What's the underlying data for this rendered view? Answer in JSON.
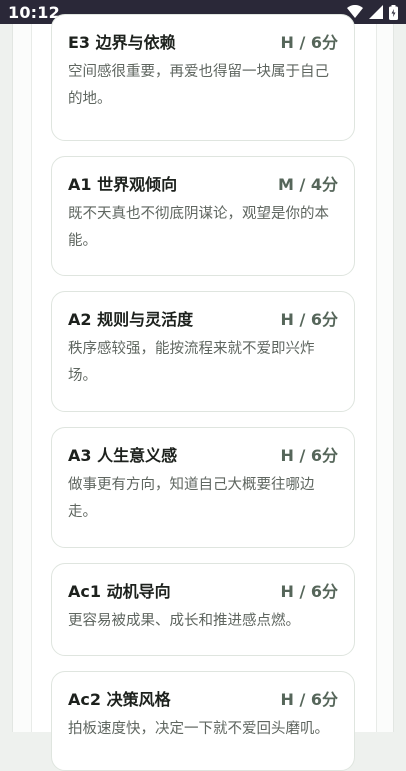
{
  "status_bar": {
    "time": "10:12"
  },
  "cards": [
    {
      "title": "E3 边界与依赖",
      "score": "H / 6分",
      "desc": "空间感很重要，再爱也得留一块属于自己的地。"
    },
    {
      "title": "A1 世界观倾向",
      "score": "M / 4分",
      "desc": "既不天真也不彻底阴谋论，观望是你的本能。"
    },
    {
      "title": "A2 规则与灵活度",
      "score": "H / 6分",
      "desc": "秩序感较强，能按流程来就不爱即兴炸场。"
    },
    {
      "title": "A3 人生意义感",
      "score": "H / 6分",
      "desc": "做事更有方向，知道自己大概要往哪边走。"
    },
    {
      "title": "Ac1 动机导向",
      "score": "H / 6分",
      "desc": "更容易被成果、成长和推进感点燃。"
    },
    {
      "title": "Ac2 决策风格",
      "score": "H / 6分",
      "desc": "拍板速度快，决定一下就不爱回头磨叽。"
    }
  ]
}
